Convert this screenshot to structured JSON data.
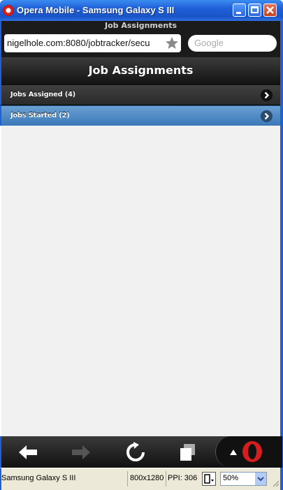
{
  "window": {
    "title": "Opera Mobile - Samsung Galaxy S III",
    "buttons": [
      "minimize",
      "maximize",
      "close"
    ]
  },
  "browser": {
    "tab_title": "Job Assignments",
    "url": "nigelhole.com:8080/jobtracker/secu",
    "search_placeholder": "Google"
  },
  "page": {
    "title": "Job Assignments",
    "items": [
      {
        "label": "Jobs Assigned (4)",
        "icon": "chevron-right-icon"
      },
      {
        "label": "Jobs Started (2)",
        "icon": "chevron-right-icon",
        "highlighted": true
      }
    ]
  },
  "toolbar": {
    "buttons": [
      "back-icon",
      "forward-icon",
      "reload-icon",
      "tabs-icon",
      "opera-menu-icon"
    ]
  },
  "statusbar": {
    "device": "Samsung Galaxy S III",
    "resolution": "800x1280",
    "ppi": "PPI: 306",
    "zoom": "50%"
  },
  "colors": {
    "titlebar": "#1f5fd8",
    "highlight": "#4a88c4",
    "header": "#2a2a2a",
    "opera_red": "#d61d1d"
  }
}
